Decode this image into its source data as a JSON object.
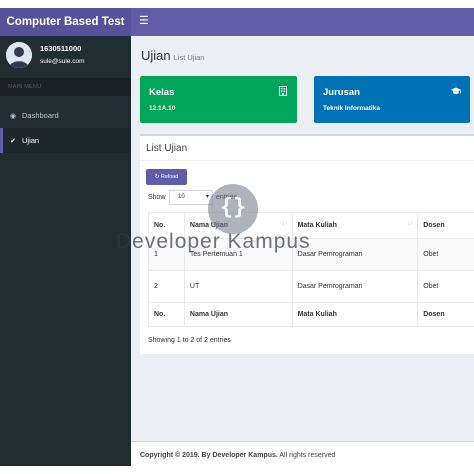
{
  "header": {
    "brand": "Computer Based Test",
    "toggle_icon": "hamburger-icon"
  },
  "sidebar": {
    "user": {
      "name": "1630511000",
      "email": "sule@sule.com",
      "avatar_icon": "user-avatar-icon"
    },
    "menu_header": "MAIN MENU",
    "items": [
      {
        "label": "Dashboard",
        "icon": "dashboard-icon",
        "active": false
      },
      {
        "label": "Ujian",
        "icon": "circle-check-icon",
        "active": true
      }
    ]
  },
  "page": {
    "title": "Ujian",
    "subtitle": "List Ujian"
  },
  "info_boxes": [
    {
      "title": "Kelas",
      "value": "12.1A.10",
      "icon": "building-icon",
      "color": "#00a65a"
    },
    {
      "title": "Jurusan",
      "value": "Teknik Informatika",
      "icon": "graduation-cap-icon",
      "color": "#0073b7"
    }
  ],
  "list": {
    "title": "List Ujian",
    "reload_label": "Reload",
    "show_label": "Show",
    "entries_value": "10",
    "entries_label": "entries",
    "columns": [
      "No.",
      "Nama Ujian",
      "Mata Kuliah",
      "Dosen"
    ],
    "rows": [
      {
        "no": "1",
        "nama": "Tes Pertemuan 1",
        "matkul": "Dasar Pemrograman",
        "dosen": "Obet"
      },
      {
        "no": "2",
        "nama": "UT",
        "matkul": "Dasar Pemrograman",
        "dosen": "Obet"
      }
    ],
    "info": "Showing 1 to 2 of 2 entries"
  },
  "footer": {
    "bold": "Copyright © 2019. By Developer Kampus.",
    "rest": " All rights reserved"
  },
  "watermark": {
    "text": "Developer Kampus",
    "glyph": "{}"
  },
  "colors": {
    "header": "#605ca8",
    "brand": "#555299",
    "sidebar": "#222d32",
    "kelas": "#00a65a",
    "jurusan": "#0073b7"
  }
}
